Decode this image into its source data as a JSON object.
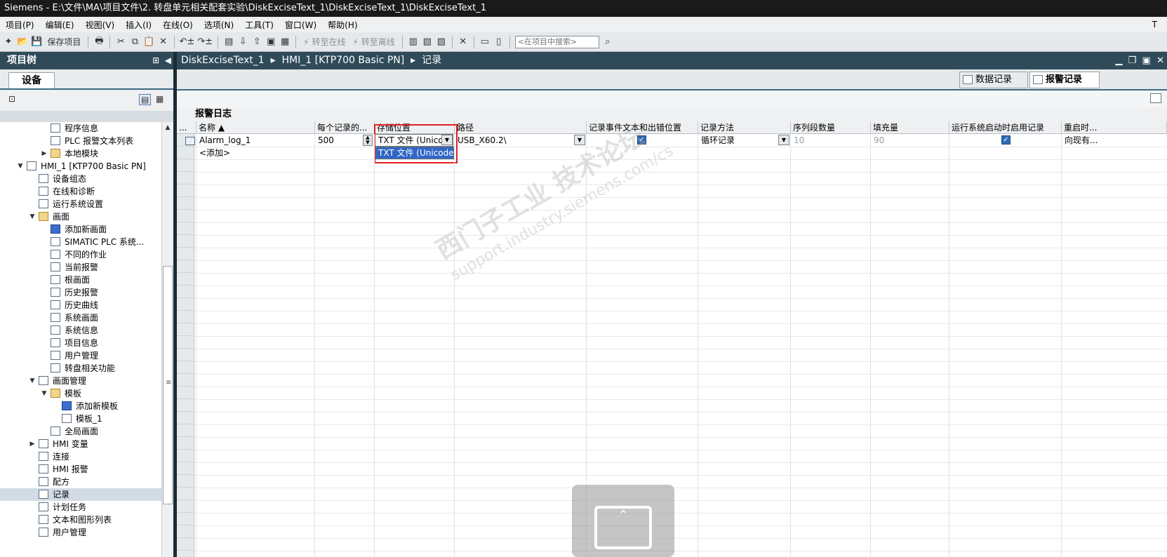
{
  "window": {
    "title": "Siemens  -  E:\\文件\\MA\\项目文件\\2. 转盘单元相关配套实验\\DiskExciseText_1\\DiskExciseText_1\\DiskExciseText_1"
  },
  "menu": {
    "items": [
      "项目(P)",
      "编辑(E)",
      "视图(V)",
      "插入(I)",
      "在线(O)",
      "选项(N)",
      "工具(T)",
      "窗口(W)",
      "帮助(H)"
    ],
    "right_label": "T"
  },
  "toolbar": {
    "save_label": "保存项目",
    "go_online": "转至在线",
    "go_offline": "转至离线",
    "search_placeholder": "<在项目中搜索>"
  },
  "project_tree": {
    "title": "项目树",
    "tab": "设备",
    "items": [
      {
        "label": "程序信息",
        "level": 3,
        "icon": "program-info-icon"
      },
      {
        "label": "PLC 报警文本列表",
        "level": 3,
        "icon": "text-list-icon"
      },
      {
        "label": "本地模块",
        "level": 3,
        "icon": "folder-icon",
        "expand": "collapsed"
      },
      {
        "label": "HMI_1 [KTP700 Basic PN]",
        "level": 1,
        "icon": "hmi-device-icon",
        "expand": "expanded"
      },
      {
        "label": "设备组态",
        "level": 2,
        "icon": "device-config-icon"
      },
      {
        "label": "在线和诊断",
        "level": 2,
        "icon": "online-diagnostics-icon"
      },
      {
        "label": "运行系统设置",
        "level": 2,
        "icon": "runtime-settings-icon"
      },
      {
        "label": "画面",
        "level": 2,
        "icon": "folder-icon",
        "expand": "expanded"
      },
      {
        "label": "添加新画面",
        "level": 3,
        "icon": "add-screen-icon"
      },
      {
        "label": "SIMATIC PLC 系统...",
        "level": 3,
        "icon": "screen-icon"
      },
      {
        "label": "不同的作业",
        "level": 3,
        "icon": "screen-icon"
      },
      {
        "label": "当前报警",
        "level": 3,
        "icon": "screen-icon"
      },
      {
        "label": "根画面",
        "level": 3,
        "icon": "root-screen-icon"
      },
      {
        "label": "历史报警",
        "level": 3,
        "icon": "screen-icon"
      },
      {
        "label": "历史曲线",
        "level": 3,
        "icon": "screen-icon"
      },
      {
        "label": "系统画面",
        "level": 3,
        "icon": "screen-icon"
      },
      {
        "label": "系统信息",
        "level": 3,
        "icon": "screen-icon"
      },
      {
        "label": "项目信息",
        "level": 3,
        "icon": "screen-icon"
      },
      {
        "label": "用户管理",
        "level": 3,
        "icon": "screen-icon"
      },
      {
        "label": "转盘相关功能",
        "level": 3,
        "icon": "screen-icon"
      },
      {
        "label": "画面管理",
        "level": 2,
        "icon": "screen-management-icon",
        "expand": "expanded"
      },
      {
        "label": "模板",
        "level": 3,
        "icon": "folder-icon",
        "expand": "expanded"
      },
      {
        "label": "添加新模板",
        "level": 4,
        "icon": "add-template-icon"
      },
      {
        "label": "模板_1",
        "level": 4,
        "icon": "template-icon"
      },
      {
        "label": "全局画面",
        "level": 3,
        "icon": "global-screen-icon"
      },
      {
        "label": "HMI 变量",
        "level": 2,
        "icon": "hmi-tags-icon",
        "expand": "collapsed"
      },
      {
        "label": "连接",
        "level": 2,
        "icon": "connections-icon"
      },
      {
        "label": "HMI 报警",
        "level": 2,
        "icon": "hmi-alarms-icon"
      },
      {
        "label": "配方",
        "level": 2,
        "icon": "recipes-icon"
      },
      {
        "label": "记录",
        "level": 2,
        "icon": "logs-icon",
        "selected": true
      },
      {
        "label": "计划任务",
        "level": 2,
        "icon": "scheduled-tasks-icon"
      },
      {
        "label": "文本和图形列表",
        "level": 2,
        "icon": "text-graphic-lists-icon"
      },
      {
        "label": "用户管理",
        "level": 2,
        "icon": "user-admin-icon"
      }
    ]
  },
  "editor": {
    "breadcrumb": [
      "DiskExciseText_1",
      "HMI_1 [KTP700 Basic PN]",
      "记录"
    ],
    "tabs": [
      {
        "label": "数据记录",
        "active": false
      },
      {
        "label": "报警记录",
        "active": true
      }
    ],
    "section_title": "报警日志",
    "columns": [
      "...",
      "名称 ▲",
      "每个记录的...",
      "存储位置",
      "路径",
      "记录事件文本和出错位置",
      "记录方法",
      "序列段数量",
      "填充量",
      "运行系统启动时启用记录",
      "重启时..."
    ],
    "row": {
      "name": "Alarm_log_1",
      "records_per_log": "500",
      "storage": "TXT 文件 (Unicode)",
      "path": "USB_X60.2\\",
      "log_event_text": true,
      "method": "循环记录",
      "segments": "10",
      "fill_level": "90",
      "enable_on_startup": true,
      "restart": "向现有..."
    },
    "add_row": "<添加>",
    "dropdown_option": "TXT 文件 (Unicode)"
  },
  "watermark": {
    "line1": "西门子工业  技术论坛",
    "line2": "support.industry.siemens.com/cs"
  }
}
